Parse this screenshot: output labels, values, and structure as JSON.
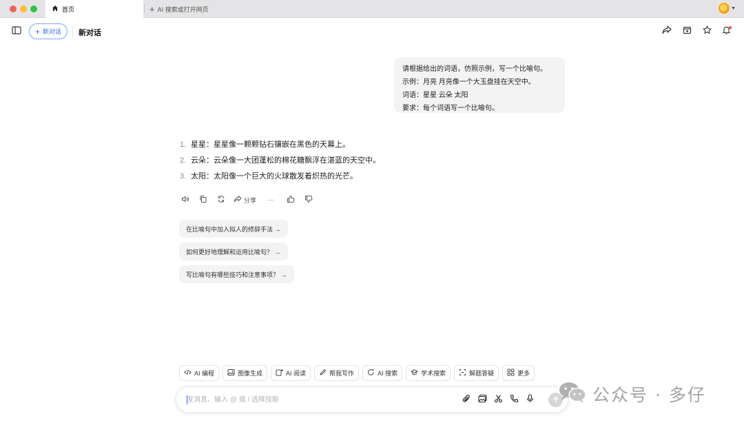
{
  "browser": {
    "tabs": [
      {
        "label": "首页",
        "icon": "home-icon",
        "active": true
      },
      {
        "label": "AI 搜索或打开网页",
        "icon": "plus-icon",
        "active": false
      }
    ]
  },
  "header": {
    "new_chat_label": "新对话",
    "title": "新对话"
  },
  "user_message": {
    "lines": [
      "请根据给出的词语，仿照示例，写一个比喻句。",
      "示例：月亮 月亮像一个大玉盘挂在天空中。",
      "词语：星星 云朵 太阳",
      "要求：每个词语写一个比喻句。"
    ]
  },
  "answer": {
    "items": [
      {
        "num": "1.",
        "text": "星星：星星像一颗颗钻石镶嵌在黑色的天幕上。"
      },
      {
        "num": "2.",
        "text": "云朵：云朵像一大团蓬松的棉花糖飘浮在湛蓝的天空中。"
      },
      {
        "num": "3.",
        "text": "太阳：太阳像一个巨大的火球散发着炽热的光芒。"
      }
    ]
  },
  "actions": {
    "share_label": "分享",
    "more_label": "···"
  },
  "suggestions": [
    "在比喻句中加入拟人的修辞手法 →",
    "如何更好地理解和运用比喻句？ →",
    "写比喻句有哪些技巧和注意事项？ →"
  ],
  "skills": [
    {
      "label": "AI 编程",
      "icon": "code-icon"
    },
    {
      "label": "图像生成",
      "icon": "image-icon"
    },
    {
      "label": "AI 阅读",
      "icon": "read-icon"
    },
    {
      "label": "帮我写作",
      "icon": "pen-icon"
    },
    {
      "label": "AI 搜索",
      "icon": "search-icon"
    },
    {
      "label": "学术搜索",
      "icon": "academic-icon"
    },
    {
      "label": "解题答疑",
      "icon": "solve-icon"
    },
    {
      "label": "更多",
      "icon": "grid-icon"
    }
  ],
  "input": {
    "placeholder": "发消息、输入 @ 或 / 选择技能"
  },
  "watermark": {
    "text": "公众号 · 多仔"
  },
  "colors": {
    "accent": "#2f6ff2",
    "bubble_bg": "#f3f3f4",
    "notification_dot": "#f04438"
  }
}
